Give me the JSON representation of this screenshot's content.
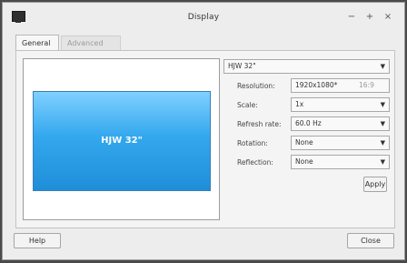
{
  "window": {
    "title": "Display"
  },
  "tabs": [
    {
      "label": "General",
      "active": true
    },
    {
      "label": "Advanced",
      "active": false
    }
  ],
  "preview": {
    "monitor_label": "HJW 32\""
  },
  "monitor_select": {
    "value": "HJW 32\""
  },
  "settings": {
    "resolution": {
      "label": "Resolution:",
      "value": "1920x1080*",
      "aspect": "16:9"
    },
    "scale": {
      "label": "Scale:",
      "value": "1x"
    },
    "refresh": {
      "label": "Refresh rate:",
      "value": "60.0 Hz"
    },
    "rotation": {
      "label": "Rotation:",
      "value": "None"
    },
    "reflection": {
      "label": "Reflection:",
      "value": "None"
    }
  },
  "buttons": {
    "apply": "Apply",
    "help": "Help",
    "close": "Close"
  },
  "titlebar_buttons": {
    "minimize": "−",
    "maximize": "+",
    "close": "×"
  },
  "icons": {
    "app": "monitor-icon",
    "dropdown": "chevron-down-icon"
  },
  "colors": {
    "screen_top": "#7fd0ff",
    "screen_bottom": "#1e8ed8"
  }
}
